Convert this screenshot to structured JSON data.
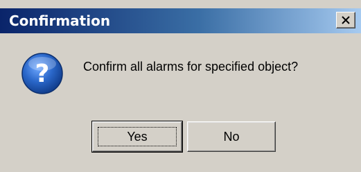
{
  "dialog": {
    "title": "Confirmation",
    "message": "Confirm all alarms for specified object?",
    "icon": "question-icon",
    "close_icon": "close-icon",
    "buttons": {
      "yes_label": "Yes",
      "no_label": "No"
    },
    "colors": {
      "titlebar_start": "#0a246a",
      "titlebar_end": "#a6caf0",
      "background": "#d4d0c8",
      "icon_blue": "#1f5fb8"
    }
  }
}
